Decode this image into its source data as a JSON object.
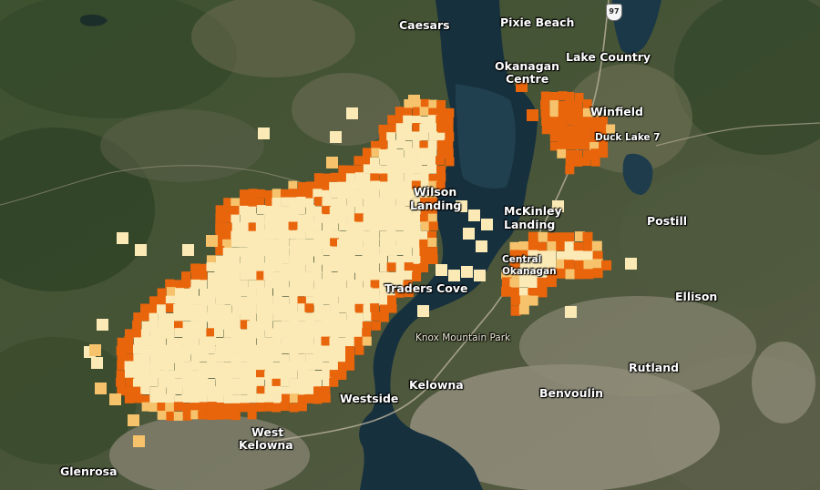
{
  "map": {
    "imagery": "satellite",
    "colors": {
      "lake": "#16303e",
      "forest": "#3a4a2c",
      "urban": "#9a9582",
      "fire_low": "#fbeab6",
      "fire_medium": "#f6c36c",
      "fire_high": "#e8650c"
    }
  },
  "labels": {
    "caesars": "Caesars",
    "pixie_beach": "Pixie Beach",
    "okanagan_centre_1": "Okanagan",
    "okanagan_centre_2": "Centre",
    "lake_country": "Lake Country",
    "winfield": "Winfield",
    "duck_lake": "Duck Lake 7",
    "wilson_landing_1": "Wilson",
    "wilson_landing_2": "Landing",
    "mckinley_landing_1": "McKinley",
    "mckinley_landing_2": "Landing",
    "postill": "Postill",
    "central_okanagan_1": "Central",
    "central_okanagan_2": "Okanagan",
    "traders_cove": "Traders Cove",
    "ellison": "Ellison",
    "knox_mountain_park": "Knox Mountain Park",
    "rutland": "Rutland",
    "westside": "Westside",
    "kelowna": "Kelowna",
    "benvoulin": "Benvoulin",
    "west_kelowna_1": "West",
    "west_kelowna_2": "Kelowna",
    "glenrosa": "Glenrosa"
  },
  "highway_shield": {
    "number": "97",
    "icon": "highway-shield-icon"
  }
}
